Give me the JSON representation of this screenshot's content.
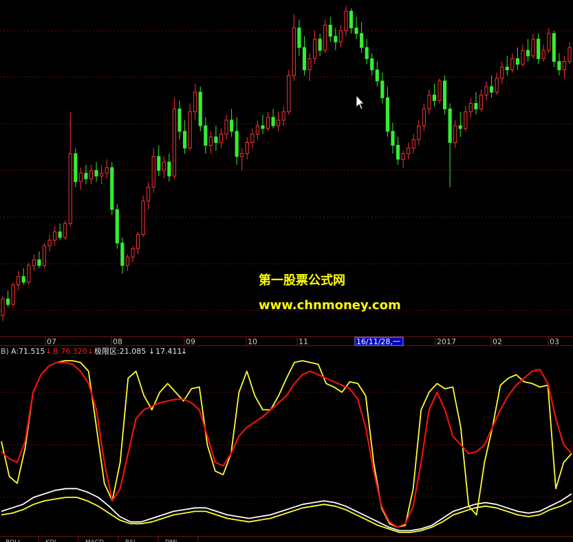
{
  "chart_data": [
    {
      "type": "candlestick",
      "date_labels": [
        "07",
        "08",
        "09",
        "10",
        "11",
        "2017",
        "02",
        "03"
      ],
      "cursor_date": "16/11/28,一",
      "up_color": "#ff3333",
      "down_color": "#33ee33",
      "candles": [
        [
          6.2,
          6.9,
          6.0,
          6.8
        ],
        [
          6.8,
          7.1,
          6.5,
          6.6
        ],
        [
          6.6,
          7.4,
          6.5,
          7.3
        ],
        [
          7.3,
          7.8,
          7.1,
          7.6
        ],
        [
          7.6,
          7.9,
          7.3,
          7.4
        ],
        [
          7.4,
          8.1,
          7.3,
          8.0
        ],
        [
          8.0,
          8.4,
          7.8,
          8.2
        ],
        [
          8.2,
          8.5,
          7.9,
          8.0
        ],
        [
          8.0,
          8.8,
          7.9,
          8.7
        ],
        [
          8.7,
          9.1,
          8.5,
          8.9
        ],
        [
          8.9,
          9.4,
          8.7,
          9.2
        ],
        [
          9.2,
          9.5,
          8.9,
          9.0
        ],
        [
          9.0,
          9.6,
          8.9,
          9.5
        ],
        [
          9.5,
          13.5,
          9.4,
          12.0
        ],
        [
          12.0,
          12.2,
          10.8,
          11.0
        ],
        [
          11.0,
          11.5,
          10.7,
          11.3
        ],
        [
          11.3,
          11.6,
          10.9,
          11.1
        ],
        [
          11.1,
          11.6,
          10.9,
          11.4
        ],
        [
          11.4,
          11.7,
          11.0,
          11.2
        ],
        [
          11.2,
          11.6,
          10.9,
          11.3
        ],
        [
          11.3,
          11.8,
          11.1,
          11.5
        ],
        [
          11.5,
          11.7,
          9.8,
          10.0
        ],
        [
          10.0,
          10.2,
          8.6,
          8.8
        ],
        [
          8.8,
          9.0,
          7.7,
          8.0
        ],
        [
          8.0,
          8.4,
          7.8,
          8.3
        ],
        [
          8.3,
          8.7,
          8.1,
          8.6
        ],
        [
          8.6,
          9.2,
          8.4,
          9.1
        ],
        [
          9.1,
          10.5,
          9.0,
          10.3
        ],
        [
          10.3,
          11.0,
          10.0,
          10.8
        ],
        [
          10.8,
          12.2,
          10.6,
          11.9
        ],
        [
          11.9,
          12.3,
          11.2,
          11.4
        ],
        [
          11.4,
          11.9,
          11.1,
          11.7
        ],
        [
          11.7,
          12.0,
          11.0,
          11.2
        ],
        [
          11.2,
          14.0,
          11.1,
          13.6
        ],
        [
          13.6,
          13.9,
          12.5,
          12.8
        ],
        [
          12.8,
          13.2,
          12.0,
          12.2
        ],
        [
          12.2,
          13.8,
          12.1,
          13.5
        ],
        [
          13.5,
          14.5,
          13.2,
          14.2
        ],
        [
          14.2,
          14.4,
          12.8,
          13.0
        ],
        [
          13.0,
          13.3,
          12.0,
          12.3
        ],
        [
          12.3,
          12.8,
          12.0,
          12.6
        ],
        [
          12.6,
          13.0,
          12.1,
          12.4
        ],
        [
          12.4,
          12.9,
          12.2,
          12.7
        ],
        [
          12.7,
          13.4,
          12.5,
          13.2
        ],
        [
          13.2,
          13.6,
          12.6,
          12.8
        ],
        [
          12.8,
          13.3,
          11.6,
          11.9
        ],
        [
          11.9,
          12.2,
          11.4,
          12.0
        ],
        [
          12.0,
          12.6,
          11.8,
          12.4
        ],
        [
          12.4,
          12.9,
          12.2,
          12.7
        ],
        [
          12.7,
          13.2,
          12.5,
          13.0
        ],
        [
          13.0,
          13.4,
          12.7,
          12.9
        ],
        [
          12.9,
          13.5,
          12.8,
          13.3
        ],
        [
          13.3,
          13.6,
          12.9,
          13.0
        ],
        [
          13.0,
          13.5,
          12.8,
          13.2
        ],
        [
          13.2,
          13.7,
          13.0,
          13.5
        ],
        [
          13.5,
          15.0,
          13.4,
          14.8
        ],
        [
          14.8,
          17.0,
          14.6,
          16.5
        ],
        [
          16.5,
          16.8,
          15.5,
          15.8
        ],
        [
          15.8,
          16.2,
          14.8,
          15.0
        ],
        [
          15.0,
          15.6,
          14.6,
          15.4
        ],
        [
          15.4,
          16.4,
          15.2,
          16.1
        ],
        [
          16.1,
          16.3,
          15.5,
          15.7
        ],
        [
          15.7,
          16.8,
          15.6,
          16.6
        ],
        [
          16.6,
          16.9,
          16.0,
          16.2
        ],
        [
          16.2,
          16.5,
          15.7,
          16.0
        ],
        [
          16.0,
          16.6,
          15.8,
          16.4
        ],
        [
          16.4,
          17.3,
          16.2,
          17.1
        ],
        [
          17.1,
          17.2,
          16.3,
          16.5
        ],
        [
          16.5,
          16.9,
          16.1,
          16.3
        ],
        [
          16.3,
          16.7,
          15.6,
          15.8
        ],
        [
          15.8,
          16.1,
          15.2,
          15.4
        ],
        [
          15.4,
          15.6,
          14.8,
          15.0
        ],
        [
          15.0,
          15.3,
          14.4,
          14.6
        ],
        [
          14.6,
          14.9,
          13.8,
          14.0
        ],
        [
          14.0,
          14.4,
          12.6,
          12.8
        ],
        [
          12.8,
          13.1,
          12.0,
          12.3
        ],
        [
          12.3,
          12.6,
          11.6,
          11.8
        ],
        [
          11.8,
          12.1,
          11.5,
          12.0
        ],
        [
          12.0,
          12.4,
          11.8,
          12.2
        ],
        [
          12.2,
          12.7,
          12.0,
          12.5
        ],
        [
          12.5,
          13.2,
          12.3,
          13.0
        ],
        [
          13.0,
          13.8,
          12.8,
          13.6
        ],
        [
          13.6,
          14.3,
          13.4,
          14.1
        ],
        [
          14.1,
          14.5,
          13.7,
          13.9
        ],
        [
          13.9,
          14.7,
          13.8,
          14.6
        ],
        [
          14.6,
          14.8,
          13.4,
          13.6
        ],
        [
          13.6,
          13.8,
          10.8,
          12.4
        ],
        [
          12.4,
          13.2,
          12.2,
          13.0
        ],
        [
          13.0,
          13.5,
          12.6,
          12.9
        ],
        [
          12.9,
          13.7,
          12.8,
          13.5
        ],
        [
          13.5,
          14.0,
          13.3,
          13.8
        ],
        [
          13.8,
          14.2,
          13.4,
          13.6
        ],
        [
          13.6,
          14.3,
          13.5,
          14.1
        ],
        [
          14.1,
          14.6,
          13.9,
          14.4
        ],
        [
          14.4,
          14.8,
          14.0,
          14.2
        ],
        [
          14.2,
          14.9,
          14.1,
          14.7
        ],
        [
          14.7,
          15.3,
          14.5,
          15.1
        ],
        [
          15.1,
          15.5,
          14.8,
          15.0
        ],
        [
          15.0,
          15.6,
          14.9,
          15.4
        ],
        [
          15.4,
          15.8,
          15.0,
          15.2
        ],
        [
          15.2,
          15.9,
          15.1,
          15.7
        ],
        [
          15.7,
          16.1,
          15.3,
          15.5
        ],
        [
          15.5,
          16.3,
          15.4,
          16.1
        ],
        [
          16.1,
          16.3,
          15.2,
          15.4
        ],
        [
          15.4,
          15.9,
          15.3,
          15.7
        ],
        [
          15.7,
          16.5,
          15.6,
          16.3
        ],
        [
          16.3,
          16.4,
          15.1,
          15.3
        ],
        [
          15.3,
          15.6,
          14.8,
          15.0
        ],
        [
          15.0,
          15.5,
          14.7,
          15.3
        ],
        [
          15.3,
          16.0,
          15.2,
          15.8
        ]
      ],
      "ylim": [
        5.5,
        17.5
      ]
    },
    {
      "type": "line",
      "header": {
        "a_label": "A:71.515",
        "b_label": "B:76.320",
        "limit_label": "极限区:21.085",
        "extra_value": "17.411",
        "down_arrow": "↓",
        "prefix": "B)"
      },
      "ylim": [
        0,
        100
      ],
      "series": [
        {
          "name": "A",
          "color": "#ffff33",
          "values": [
            52,
            32,
            28,
            48,
            80,
            90,
            95,
            97,
            98,
            98,
            97,
            92,
            60,
            28,
            18,
            40,
            88,
            92,
            78,
            70,
            80,
            85,
            80,
            75,
            82,
            83,
            50,
            35,
            33,
            45,
            80,
            92,
            78,
            70,
            70,
            78,
            88,
            97,
            98,
            97,
            96,
            85,
            83,
            80,
            86,
            85,
            78,
            40,
            14,
            5,
            3,
            4,
            25,
            70,
            80,
            85,
            82,
            83,
            60,
            15,
            10,
            40,
            60,
            84,
            88,
            90,
            86,
            85,
            83,
            84,
            25,
            40,
            45
          ]
        },
        {
          "name": "B",
          "color": "#ee1111",
          "values": [
            46,
            42,
            40,
            52,
            80,
            90,
            95,
            97,
            97,
            96,
            92,
            85,
            70,
            40,
            18,
            25,
            45,
            65,
            70,
            72,
            74,
            75,
            76,
            76,
            74,
            70,
            55,
            40,
            38,
            45,
            55,
            60,
            63,
            66,
            70,
            74,
            78,
            85,
            90,
            92,
            90,
            88,
            86,
            84,
            82,
            76,
            60,
            35,
            15,
            6,
            3,
            5,
            15,
            40,
            70,
            80,
            70,
            55,
            50,
            45,
            46,
            50,
            60,
            70,
            78,
            84,
            88,
            92,
            93,
            85,
            65,
            50,
            45
          ]
        },
        {
          "name": "白线",
          "color": "#ffffff",
          "values": [
            12,
            14,
            16,
            20,
            22,
            24,
            25,
            25,
            23,
            20,
            15,
            9,
            6,
            6,
            8,
            10,
            12,
            13,
            14,
            14,
            12,
            10,
            9,
            8,
            9,
            10,
            12,
            14,
            16,
            17,
            18,
            17,
            15,
            12,
            9,
            6,
            3,
            1,
            1,
            2,
            4,
            8,
            12,
            14,
            16,
            17,
            16,
            14,
            12,
            11,
            12,
            15,
            18,
            22
          ]
        },
        {
          "name": "黄线",
          "color": "#ffff33",
          "values": [
            10,
            11,
            13,
            16,
            18,
            19,
            20,
            20,
            18,
            15,
            11,
            7,
            5,
            5,
            6,
            8,
            10,
            11,
            12,
            12,
            10,
            8,
            7,
            6,
            7,
            8,
            10,
            12,
            14,
            15,
            16,
            15,
            13,
            10,
            7,
            4,
            2,
            0,
            0,
            1,
            3,
            6,
            10,
            12,
            14,
            15,
            14,
            12,
            10,
            9,
            10,
            13,
            15,
            18
          ]
        }
      ]
    }
  ],
  "watermark": {
    "title": "第一股票公式网",
    "url": "www.chnmoney.com"
  },
  "bottom_tabs": [
    "BOLL",
    "KDJ",
    "MACD",
    "RSI",
    "DMI"
  ]
}
